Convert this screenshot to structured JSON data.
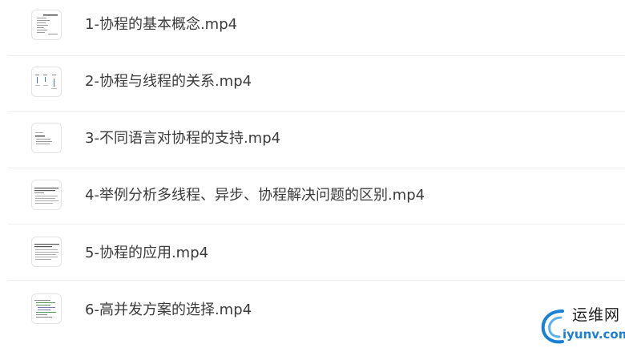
{
  "files": [
    {
      "name": "1-协程的基本概念.mp4",
      "thumb_icon": "document-thumbnail-icon"
    },
    {
      "name": "2-协程与线程的关系.mp4",
      "thumb_icon": "diagram-thumbnail-icon"
    },
    {
      "name": "3-不同语言对协程的支持.mp4",
      "thumb_icon": "document-thumbnail-icon"
    },
    {
      "name": "4-举例分析多线程、异步、协程解决问题的区别.mp4",
      "thumb_icon": "document-thumbnail-icon"
    },
    {
      "name": "5-协程的应用.mp4",
      "thumb_icon": "document-thumbnail-icon"
    },
    {
      "name": "6-高并发方案的选择.mp4",
      "thumb_icon": "code-thumbnail-icon"
    }
  ],
  "watermark": {
    "text_cn": "运维网",
    "text_en": "iyunv.com",
    "color_accent": "#1a7fd6"
  }
}
